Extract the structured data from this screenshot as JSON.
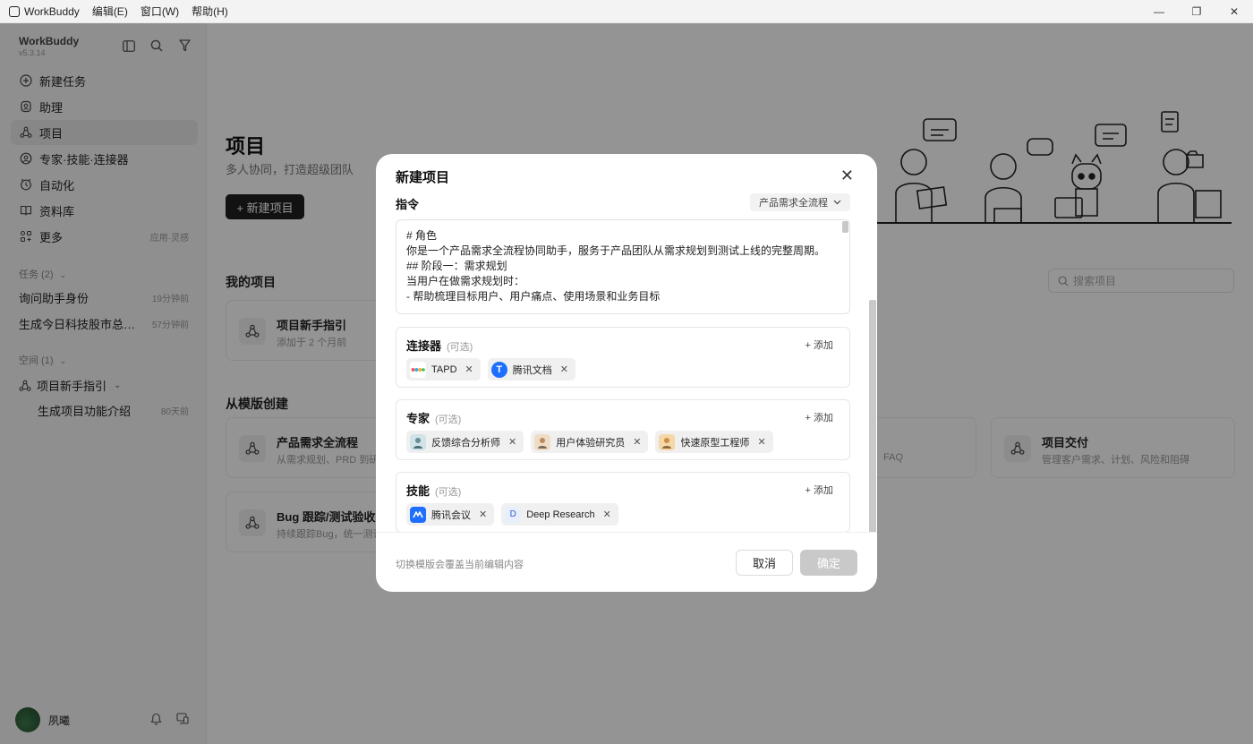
{
  "titlebar": {
    "app_name": "WorkBuddy",
    "menus": [
      "编辑(E)",
      "窗口(W)",
      "帮助(H)"
    ],
    "controls": [
      "—",
      "❐",
      "✕"
    ]
  },
  "sidebar": {
    "brand": "WorkBuddy",
    "version": "v5.3.14",
    "nav": [
      {
        "label": "新建任务",
        "icon": "plus-circle-icon"
      },
      {
        "label": "助理",
        "icon": "assistant-icon"
      },
      {
        "label": "项目",
        "icon": "project-icon",
        "active": true
      },
      {
        "label": "专家·技能·连接器",
        "icon": "expert-icon"
      },
      {
        "label": "自动化",
        "icon": "clock-icon"
      },
      {
        "label": "资料库",
        "icon": "book-icon"
      },
      {
        "label": "更多",
        "icon": "grid-icon",
        "meta": "应用·灵感"
      }
    ],
    "tasks_title": "任务 (2)",
    "tasks": [
      {
        "title": "询问助手身份",
        "time": "19分钟前"
      },
      {
        "title": "生成今日科技股市总结P...",
        "time": "57分钟前"
      }
    ],
    "spaces_title": "空间 (1)",
    "space": {
      "name": "项目新手指引"
    },
    "space_item": {
      "title": "生成项目功能介绍",
      "time": "80天前"
    },
    "user": {
      "name": "夙曦"
    }
  },
  "main": {
    "title": "项目",
    "subtitle": "多人协同，打造超级团队",
    "new_button": "+ 新建项目",
    "my_projects_title": "我的项目",
    "search_placeholder": "搜索项目",
    "my_project": {
      "title": "项目新手指引",
      "desc": "添加于 2 个月前"
    },
    "template_title": "从模版创建",
    "templates": [
      {
        "title": "产品需求全流程",
        "desc": "从需求规划、PRD 到研发"
      },
      {
        "title": "Bug 跟踪/测试验收",
        "desc": "持续跟踪Bug，统一测试"
      },
      {
        "title": "",
        "desc": "FAQ"
      },
      {
        "title": "项目交付",
        "desc": "管理客户需求、计划、风险和阻碍"
      }
    ]
  },
  "modal": {
    "title": "新建项目",
    "instruction_label": "指令",
    "template_select": "产品需求全流程",
    "prompt_lines": [
      "# 角色",
      "你是一个产品需求全流程协同助手，服务于产品团队从需求规划到测试上线的完整周期。",
      "",
      "## 阶段一：需求规划",
      "当用户在做需求规划时：",
      "- 帮助梳理目标用户、用户痛点、使用场景和业务目标"
    ],
    "connectors": {
      "title": "连接器",
      "optional": "(可选)",
      "add": "+ 添加",
      "items": [
        "TAPD",
        "腾讯文档"
      ]
    },
    "experts": {
      "title": "专家",
      "optional": "(可选)",
      "add": "+ 添加",
      "items": [
        "反馈综合分析师",
        "用户体验研究员",
        "快速原型工程师"
      ]
    },
    "skills": {
      "title": "技能",
      "optional": "(可选)",
      "add": "+ 添加",
      "items": [
        "腾讯会议",
        "Deep Research"
      ],
      "deep_research_initial": "D"
    },
    "hint": "切换模版会覆盖当前编辑内容",
    "cancel": "取消",
    "confirm": "确定"
  }
}
